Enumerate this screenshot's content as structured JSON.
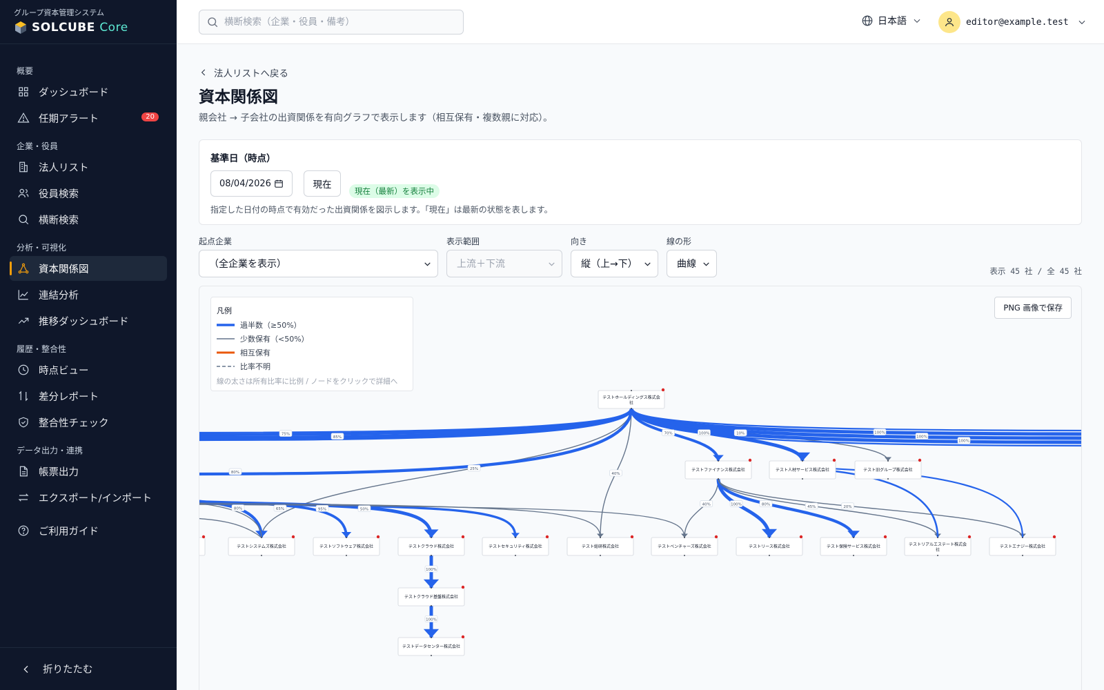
{
  "sidebar": {
    "system_label": "グループ資本管理システム",
    "brand_name": "SOLCUBE",
    "brand_suffix": "Core",
    "sections": [
      {
        "title": "概要",
        "items": [
          {
            "label": "ダッシュボード",
            "icon": "grid-icon"
          },
          {
            "label": "任期アラート",
            "icon": "alert-triangle-icon",
            "badge": "20"
          }
        ]
      },
      {
        "title": "企業・役員",
        "items": [
          {
            "label": "法人リスト",
            "icon": "building-icon"
          },
          {
            "label": "役員検索",
            "icon": "users-icon"
          },
          {
            "label": "横断検索",
            "icon": "search-icon"
          }
        ]
      },
      {
        "title": "分析・可視化",
        "items": [
          {
            "label": "資本関係図",
            "icon": "network-icon",
            "active": true
          },
          {
            "label": "連結分析",
            "icon": "line-chart-icon"
          },
          {
            "label": "推移ダッシュボード",
            "icon": "trending-up-icon"
          }
        ]
      },
      {
        "title": "履歴・整合性",
        "items": [
          {
            "label": "時点ビュー",
            "icon": "clock-icon"
          },
          {
            "label": "差分レポート",
            "icon": "swap-vertical-icon"
          },
          {
            "label": "整合性チェック",
            "icon": "shield-check-icon"
          }
        ]
      },
      {
        "title": "データ出力・連携",
        "items": [
          {
            "label": "帳票出力",
            "icon": "document-icon"
          },
          {
            "label": "エクスポート/インポート",
            "icon": "swap-horizontal-icon"
          },
          {
            "label": "ご利用ガイド",
            "icon": "help-circle-icon"
          }
        ]
      }
    ],
    "collapse_label": "折りたたむ"
  },
  "header": {
    "search_placeholder": "横断検索（企業・役員・備考）",
    "language": "日本語",
    "user_email": "editor@example.test"
  },
  "page": {
    "back_link": "法人リストへ戻る",
    "title": "資本関係図",
    "subtitle": "親会社 → 子会社の出資関係を有向グラフで表示します（相互保有・複数親に対応）。"
  },
  "date_card": {
    "label": "基準日（時点）",
    "date_value": "08/04/2026",
    "now_button": "現在",
    "status_pill": "現在（最新）を表示中",
    "note": "指定した日付の時点で有効だった出資関係を図示します。「現在」は最新の状態を表します。"
  },
  "controls": {
    "origin": {
      "label": "起点企業",
      "value": "（全企業を表示）"
    },
    "scope": {
      "label": "表示範囲",
      "value": "上流＋下流"
    },
    "direction": {
      "label": "向き",
      "value": "縦（上→下）"
    },
    "line_shape": {
      "label": "線の形",
      "value": "曲線"
    },
    "count_text": "表示 45 社 / 全 45 社"
  },
  "graph": {
    "png_button": "PNG 画像で保存",
    "legend": {
      "title": "凡例",
      "items": [
        {
          "label": "過半数（≥50%）",
          "color": "#2563eb",
          "style": "thick"
        },
        {
          "label": "少数保有（<50%）",
          "color": "#64748b",
          "style": "thin"
        },
        {
          "label": "相互保有",
          "color": "#ea580c",
          "style": "thick"
        },
        {
          "label": "比率不明",
          "color": "#64748b",
          "style": "dashed"
        }
      ],
      "note": "線の太さは所有比率に比例 / ノードをクリックで詳細へ"
    },
    "colors": {
      "majority": "#2563eb",
      "minority": "#64748b",
      "node_dot": "#dc2626"
    },
    "nodes": [
      {
        "id": "hd",
        "label": "テストホールディングス株式会社"
      },
      {
        "id": "fin",
        "label": "テストファイナンス株式会社"
      },
      {
        "id": "hr",
        "label": "テスト人材サービス株式会社"
      },
      {
        "id": "old",
        "label": "テスト旧グループ株式会社"
      },
      {
        "id": "edge0",
        "label": ""
      },
      {
        "id": "sys",
        "label": "テストシステムズ株式会社"
      },
      {
        "id": "sw",
        "label": "テストソフトウェア株式会社"
      },
      {
        "id": "cloud",
        "label": "テストクラウド株式会社"
      },
      {
        "id": "sec",
        "label": "テストセキュリティ株式会社"
      },
      {
        "id": "lab",
        "label": "テスト総研株式会社"
      },
      {
        "id": "vc",
        "label": "テストベンチャーズ株式会社"
      },
      {
        "id": "lease",
        "label": "テストリース株式会社"
      },
      {
        "id": "ins",
        "label": "テスト保険サービス株式会社"
      },
      {
        "id": "re",
        "label": "テストリアルエステート株式会社"
      },
      {
        "id": "en",
        "label": "テストエナジー株式会社"
      },
      {
        "id": "cbase",
        "label": "テストクラウド基盤株式会社"
      },
      {
        "id": "dc",
        "label": "テストデータセンター株式会社"
      }
    ],
    "edges": [
      {
        "from": "hd",
        "to": "fin",
        "pct": "70%",
        "kind": "majority"
      },
      {
        "from": "hd",
        "to": "hr",
        "pct": "100%",
        "kind": "majority"
      },
      {
        "from": "hd",
        "to": "old",
        "pct": "10%",
        "kind": "minority"
      },
      {
        "from": "hd",
        "to": "sys",
        "pct": "25%",
        "kind": "minority"
      },
      {
        "from": "hd",
        "to": "lab",
        "pct": "40%",
        "kind": "minority"
      },
      {
        "from": "hd",
        "to": "offscreen1",
        "pct": "75%",
        "kind": "majority"
      },
      {
        "from": "hd",
        "to": "offscreen2",
        "pct": "85%",
        "kind": "majority"
      },
      {
        "from": "hd",
        "to": "offscreen3",
        "pct": "80%",
        "kind": "majority"
      },
      {
        "from": "hd",
        "to": "offscreen4",
        "pct": "100%",
        "kind": "majority"
      },
      {
        "from": "hd",
        "to": "offscreen5",
        "pct": "100%",
        "kind": "majority"
      },
      {
        "from": "hd",
        "to": "offscreen6",
        "pct": "100%",
        "kind": "majority"
      },
      {
        "from": "left",
        "to": "sys",
        "pct": "80%",
        "kind": "majority"
      },
      {
        "from": "left",
        "to": "sw",
        "pct": "65%",
        "kind": "majority"
      },
      {
        "from": "left",
        "to": "cloud",
        "pct": "95%",
        "kind": "majority"
      },
      {
        "from": "left",
        "to": "sec",
        "pct": "50%",
        "kind": "majority"
      },
      {
        "from": "fin",
        "to": "vc",
        "pct": "40%",
        "kind": "minority"
      },
      {
        "from": "fin",
        "to": "lease",
        "pct": "100%",
        "kind": "majority"
      },
      {
        "from": "fin",
        "to": "ins",
        "pct": "80%",
        "kind": "majority"
      },
      {
        "from": "fin",
        "to": "re",
        "pct": "45%",
        "kind": "minority"
      },
      {
        "from": "fin",
        "to": "en",
        "pct": "20%",
        "kind": "minority"
      },
      {
        "from": "cloud",
        "to": "cbase",
        "pct": "100%",
        "kind": "majority"
      },
      {
        "from": "cbase",
        "to": "dc",
        "pct": "100%",
        "kind": "majority"
      }
    ]
  }
}
